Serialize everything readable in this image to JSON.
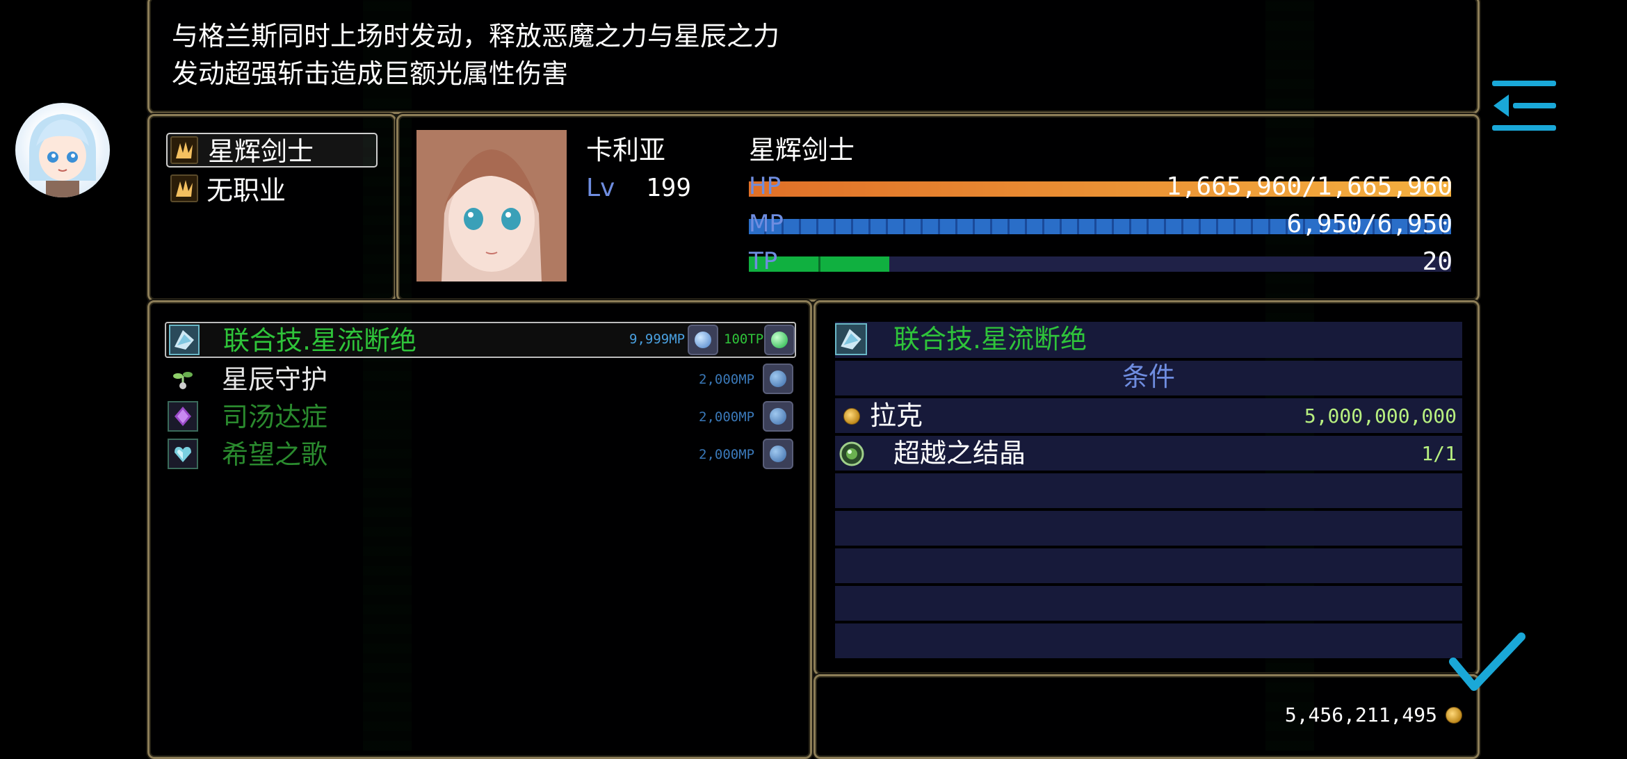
{
  "description": {
    "line1": "与格兰斯同时上场时发动，释放恶魔之力与星辰之力",
    "line2": "发动超强斩击造成巨额光属性伤害"
  },
  "classes": [
    {
      "label": "星辉剑士",
      "selected": true
    },
    {
      "label": "无职业",
      "selected": false
    }
  ],
  "character": {
    "name": "卡利亚",
    "lv_label": "Lv",
    "level": "199",
    "class_name": "星辉剑士",
    "hp_label": "HP",
    "hp_text": "1,665,960/1,665,960",
    "hp_fraction": 1.0,
    "mp_label": "MP",
    "mp_text": "6,950/6,950",
    "mp_fraction": 1.0,
    "tp_label": "TP",
    "tp_text": "20",
    "tp_fraction": 0.2
  },
  "skills": [
    {
      "name": "联合技.星流断绝",
      "mp_cost": "9,999MP",
      "tp_cost": "100TP",
      "icon": "crystal-icon",
      "color": "#2fc43a"
    },
    {
      "name": "星辰守护",
      "mp_cost": "2,000MP",
      "tp_cost": "",
      "icon": "sprout-icon",
      "color": "#e8e8e8"
    },
    {
      "name": "司汤达症",
      "mp_cost": "2,000MP",
      "tp_cost": "",
      "icon": "diamond-icon",
      "color": "#2a8a2e"
    },
    {
      "name": "希望之歌",
      "mp_cost": "2,000MP",
      "tp_cost": "",
      "icon": "heart-gem-icon",
      "color": "#2a8a2e"
    }
  ],
  "requirements": {
    "skill_name": "联合技.星流断绝",
    "header": "条件",
    "items": [
      {
        "name": "拉克",
        "value": "5,000,000,000",
        "icon": "coin-icon"
      },
      {
        "name": "超越之结晶",
        "value": "1/1",
        "icon": "crystal-orb-icon"
      }
    ]
  },
  "gold": {
    "amount": "5,456,211,495",
    "icon": "coin-icon"
  },
  "colors": {
    "accent_green": "#2fc43a",
    "hp_bar": "#f0a030",
    "mp_bar": "#2f8fe0",
    "tp_bar": "#1ec24a",
    "mp_cost_blue": "#4aa0e0",
    "panel_border": "#8c7d57",
    "menu_icon": "#1aa8d8"
  },
  "icons": {
    "menu": "menu-back-icon",
    "confirm": "checkmark-icon"
  }
}
